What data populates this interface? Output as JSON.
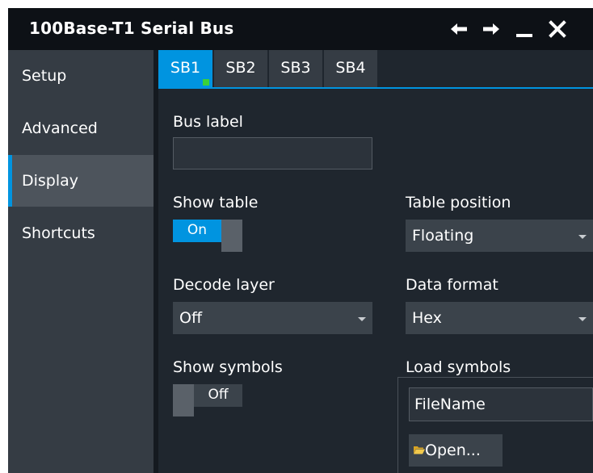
{
  "window": {
    "title": "100Base-T1 Serial Bus",
    "controls": [
      "back-arrow",
      "forward-arrow",
      "minimize",
      "close"
    ]
  },
  "sidebar": {
    "items": [
      {
        "label": "Setup",
        "active": false
      },
      {
        "label": "Advanced",
        "active": false
      },
      {
        "label": "Display",
        "active": true
      },
      {
        "label": "Shortcuts",
        "active": false
      }
    ]
  },
  "tabs": [
    {
      "label": "SB1",
      "active": true
    },
    {
      "label": "SB2",
      "active": false
    },
    {
      "label": "SB3",
      "active": false
    },
    {
      "label": "SB4",
      "active": false
    }
  ],
  "form": {
    "bus_label": {
      "label": "Bus label",
      "value": ""
    },
    "show_table": {
      "label": "Show table",
      "value": "On"
    },
    "table_position": {
      "label": "Table position",
      "value": "Floating"
    },
    "decode_layer": {
      "label": "Decode layer",
      "value": "Off"
    },
    "data_format": {
      "label": "Data format",
      "value": "Hex"
    },
    "show_symbols": {
      "label": "Show symbols",
      "value": "Off"
    },
    "load_symbols": {
      "label": "Load symbols",
      "filename": "FileName",
      "open_label": "Open..."
    }
  },
  "colors": {
    "accent": "#0094e0",
    "active_indicator": "#3ad13a",
    "title_bar": "#0d1116",
    "panel_bg": "#1f262e",
    "sidebar_bg": "#353c44"
  }
}
